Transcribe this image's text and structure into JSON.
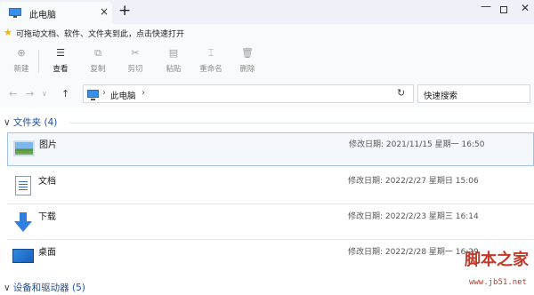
{
  "tab": {
    "title": "此电脑",
    "close": "×",
    "new_tab": "+"
  },
  "window": {
    "minimize": "—",
    "close": "✕"
  },
  "favorites": {
    "text": "可拖动文档、软件、文件夹到此，点击快速打开"
  },
  "toolbar": {
    "new": "新建",
    "view": "查看",
    "copy": "复制",
    "cut": "剪切",
    "paste": "粘贴",
    "rename": "重命名",
    "delete": "删除"
  },
  "address": {
    "location": "此电脑",
    "sep": "›",
    "search_placeholder": "快速搜索"
  },
  "groups": [
    {
      "label": "文件夹 (4)"
    },
    {
      "label": "设备和驱动器 (5)"
    }
  ],
  "folders": [
    {
      "name": "图片",
      "date": "修改日期: 2021/11/15 星期一 16:50",
      "icon": "pictures-icon"
    },
    {
      "name": "文档",
      "date": "修改日期: 2022/2/27 星期日 15:06",
      "icon": "documents-icon"
    },
    {
      "name": "下载",
      "date": "修改日期: 2022/2/23 星期三 16:14",
      "icon": "download-icon"
    },
    {
      "name": "桌面",
      "date": "修改日期: 2022/2/28 星期一 16:29",
      "icon": "desktop-icon"
    }
  ],
  "watermark": {
    "text": "脚本之家",
    "url": "www.jb51.net"
  },
  "colors": {
    "accent": "#1e4e9c",
    "selection_border": "#9fc3ec",
    "selection_bg": "#f4f8fd"
  }
}
